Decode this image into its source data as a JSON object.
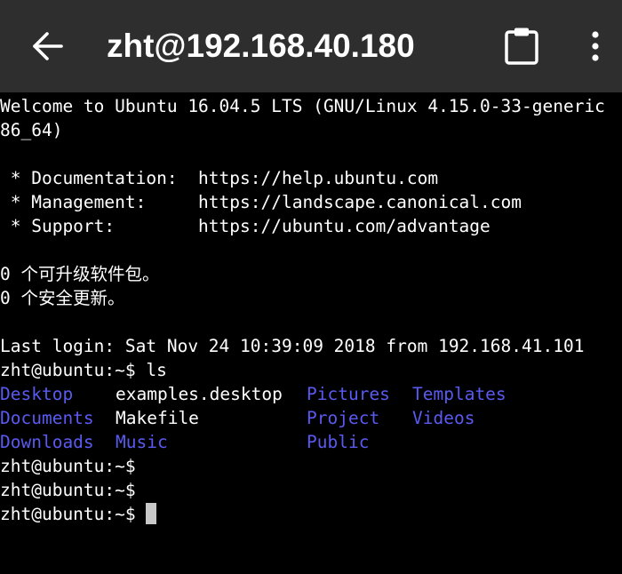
{
  "app": {
    "title": "zht@192.168.40.180",
    "icons": {
      "back": "arrow-left-icon",
      "clipboard": "clipboard-icon",
      "more": "more-vert-icon"
    }
  },
  "colors": {
    "appbar_bg": "#2e2e2e",
    "terminal_bg": "#000000",
    "text": "#ffffff",
    "directory": "#5a5af0",
    "cursor": "#c8c8c8"
  },
  "terminal": {
    "lines": [
      "Welcome to Ubuntu 16.04.5 LTS (GNU/Linux 4.15.0-33-generic",
      "86_64)",
      "",
      " * Documentation:  https://help.ubuntu.com",
      " * Management:     https://landscape.canonical.com",
      " * Support:        https://ubuntu.com/advantage",
      "",
      "0 个可升级软件包。",
      "0 个安全更新。",
      "",
      "Last login: Sat Nov 24 10:39:09 2018 from 192.168.41.101",
      "zht@ubuntu:~$ ls"
    ],
    "ls_rows": [
      [
        {
          "name": "Desktop",
          "kind": "dir"
        },
        {
          "name": "examples.desktop",
          "kind": "file"
        },
        {
          "name": "Pictures",
          "kind": "dir"
        },
        {
          "name": "Templates",
          "kind": "dir"
        }
      ],
      [
        {
          "name": "Documents",
          "kind": "dir"
        },
        {
          "name": "Makefile",
          "kind": "file"
        },
        {
          "name": "Project",
          "kind": "dir"
        },
        {
          "name": "Videos",
          "kind": "dir"
        }
      ],
      [
        {
          "name": "Downloads",
          "kind": "dir"
        },
        {
          "name": "Music",
          "kind": "dir"
        },
        {
          "name": "Public",
          "kind": "dir"
        }
      ]
    ],
    "prompt_lines": [
      "zht@ubuntu:~$",
      "zht@ubuntu:~$",
      "zht@ubuntu:~$ "
    ]
  }
}
